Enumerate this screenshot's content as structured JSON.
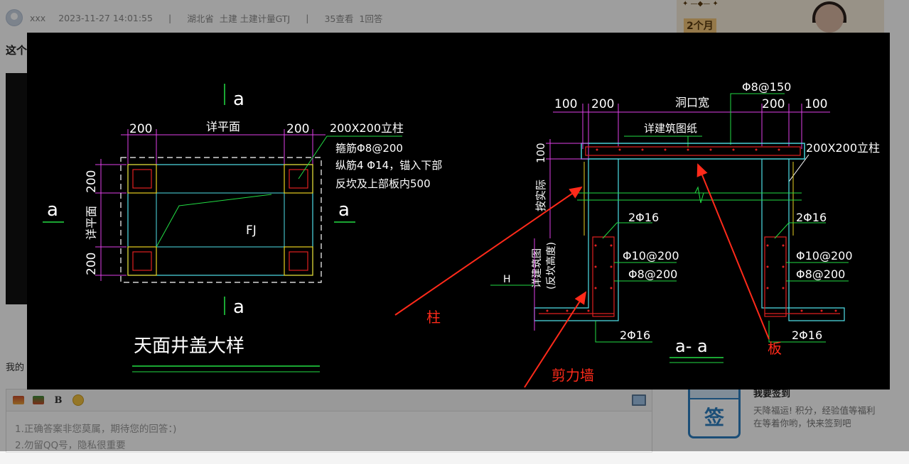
{
  "post_meta": {
    "username": "xxx",
    "datetime": "2023-11-27 14:01:55",
    "separator": "|",
    "region": "湖北省",
    "category": "土建 土建计量GTJ",
    "views": "35查看",
    "answers": "1回答"
  },
  "question_prefix": "这个",
  "my_answer_label": "我的",
  "editor": {
    "bold_label": "B",
    "placeholder_line1": "1.正确答案非您莫属，期待您的回答：)",
    "placeholder_line2": "2.勿留QQ号，隐私很重要"
  },
  "promo": {
    "badge": "2个月",
    "deco": "✦ —◆— ✦"
  },
  "sign_in": {
    "icon_char": "签",
    "title": "我要签到",
    "description": "天降福运! 积分，经验值等福利在等着你哟，快来签到吧"
  },
  "drawing": {
    "plan_title": "天面井盖大样",
    "section_title": "a- a",
    "section_marker": "a",
    "dim_200": "200",
    "dim_100": "100",
    "plan_top_label": "详平面",
    "plan_side_label": "详平面",
    "plan_fj": "FJ",
    "col_label": "200X200立柱",
    "note_line1": "箍筋Φ8@200",
    "note_line2": "纵筋4 Φ14，锚入下部",
    "note_line3": "反坎及上部板内500",
    "opening_width": "洞口宽",
    "rebar_top": "Φ8@150",
    "see_arch": "详建筑图纸",
    "section_col": "200X200立柱",
    "height_100": "100",
    "per_actual": "按实际",
    "see_arch_vert": "详建筑图",
    "curb_height": "(反坎高度)",
    "h_mark": "H",
    "rebar_2phi16": "2Φ16",
    "rebar_phi10": "Φ10@200",
    "rebar_phi8": "Φ8@200"
  },
  "annotations": {
    "column": "柱",
    "shear_wall": "剪力墙",
    "slab": "板"
  },
  "colors": {
    "annotation_red": "#ff2a1a",
    "cad_white": "#ffffff",
    "cad_cyan": "#4fe0e8",
    "cad_magenta": "#e040e8",
    "cad_green": "#22dd44",
    "cad_yellow": "#e8d020",
    "cad_red": "#e02020"
  }
}
